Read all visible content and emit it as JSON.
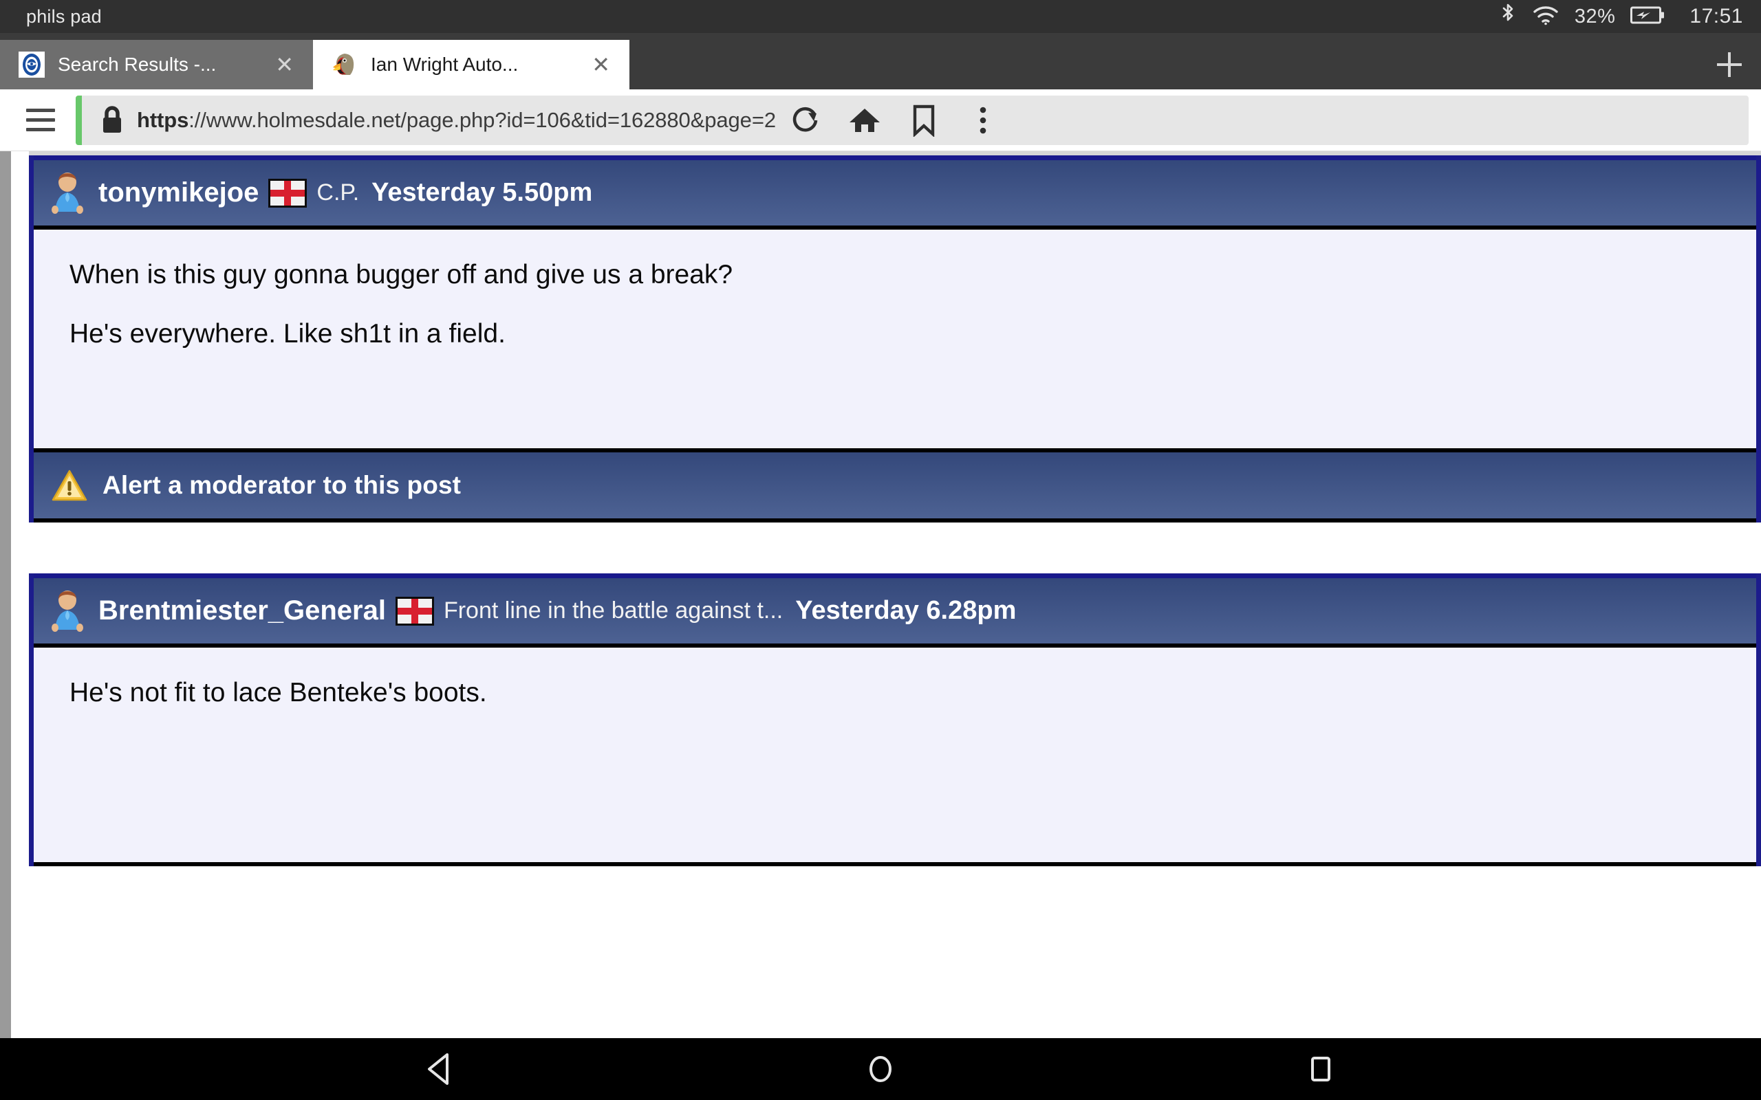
{
  "status_bar": {
    "device_name": "phils pad",
    "bluetooth_icon": "bluetooth-icon",
    "wifi_icon": "wifi-icon",
    "battery_percent": "32%",
    "battery_icon": "battery-charging-icon",
    "clock": "17:51"
  },
  "browser": {
    "tabs": [
      {
        "label": "Search Results -...",
        "favicon": "crystal-palace-badge-icon",
        "close_label": "✕",
        "active": false
      },
      {
        "label": "Ian Wright Auto...",
        "favicon": "eagle-favicon",
        "close_label": "✕",
        "active": true
      }
    ],
    "new_tab_label": "+",
    "toolbar": {
      "menu_icon": "hamburger-menu-icon",
      "lock_icon": "lock-icon",
      "url_scheme": "https",
      "url_rest": "://www.holmesdale.net/page.php?id=106&tid=162880&page=2",
      "url_full": "https://www.holmesdale.net/page.php?id=106&tid=162880&page=2",
      "reload_icon": "reload-icon",
      "home_icon": "home-icon",
      "bookmark_icon": "bookmark-icon",
      "overflow_icon": "three-dot-menu-icon",
      "security_color": "#68c86a"
    }
  },
  "forum": {
    "posts": [
      {
        "avatar_icon": "user-avatar-icon",
        "username": "tonymikejoe",
        "flag_icon": "england-flag-icon",
        "user_title": "C.P.",
        "timestamp": "Yesterday 5.50pm",
        "lines": [
          "When is this guy gonna bugger off and give us a break?",
          "He's everywhere. Like sh1t in a field."
        ],
        "alert": {
          "icon": "warning-triangle-icon",
          "label": "Alert a moderator to this post"
        }
      },
      {
        "avatar_icon": "user-avatar-icon",
        "username": "Brentmiester_General",
        "flag_icon": "england-flag-icon",
        "user_title": "Front line in the battle against t...",
        "timestamp": "Yesterday 6.28pm",
        "lines": [
          "He's not fit to lace Benteke's boots."
        ]
      }
    ]
  },
  "nav_bar": {
    "back_icon": "back-triangle-icon",
    "home_icon": "home-circle-icon",
    "recents_icon": "recents-square-icon"
  },
  "colors": {
    "header_gradient_top": "#34487b",
    "header_gradient_bottom": "#4d6293",
    "post_border": "#1c1c8c",
    "post_body_bg": "#f2f2fc",
    "status_bar_bg": "#303030",
    "tab_strip_bg": "#3b3b3b"
  }
}
